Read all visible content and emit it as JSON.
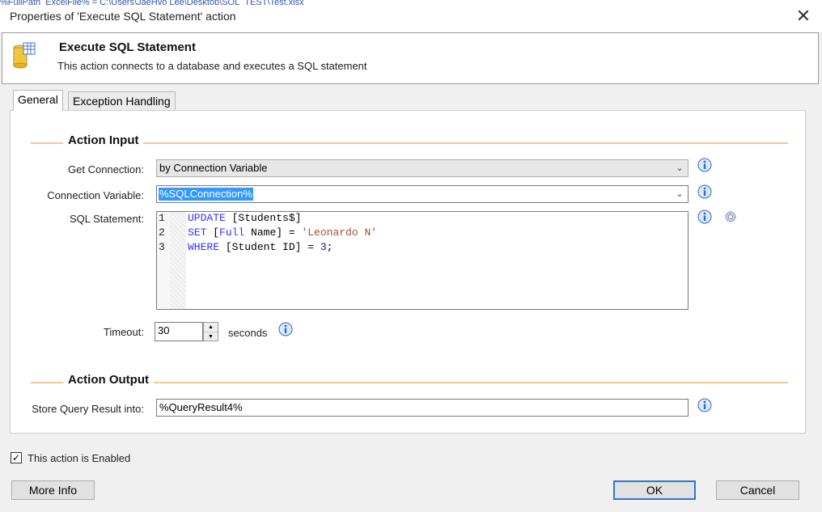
{
  "window": {
    "title": "Properties of 'Execute SQL Statement' action",
    "background_strip": "%FullPath_ExcelFile% = C:\\Users\\JaeHyo Lee\\Desktop\\SQL_TEST\\Test.xlsx"
  },
  "header": {
    "title": "Execute SQL Statement",
    "description": "This action connects to a database and executes a SQL statement",
    "icon": "database-table-icon"
  },
  "tabs": [
    {
      "label": "General",
      "active": true
    },
    {
      "label": "Exception Handling",
      "active": false
    }
  ],
  "action_input": {
    "title": "Action Input",
    "get_connection": {
      "label": "Get Connection:",
      "value": "by Connection Variable"
    },
    "connection_variable": {
      "label": "Connection Variable:",
      "value": "%SQLConnection%"
    },
    "sql_statement": {
      "label": "SQL Statement:",
      "line_numbers": [
        "1",
        "2",
        "3"
      ]
    },
    "timeout": {
      "label": "Timeout:",
      "value": "30",
      "unit": "seconds"
    }
  },
  "action_output": {
    "title": "Action Output",
    "store_result": {
      "label": "Store Query Result into:",
      "value": "%QueryResult4%"
    }
  },
  "enabled_checkbox": {
    "label": "This action is Enabled",
    "checked": true
  },
  "buttons": {
    "more_info": "More Info",
    "ok": "OK",
    "cancel": "Cancel"
  },
  "colors": {
    "section_line": "#f2c896",
    "keyword": "#3333ff",
    "string": "#a0522d",
    "selection": "#3399ff",
    "info_icon": "#2d6bc4"
  }
}
